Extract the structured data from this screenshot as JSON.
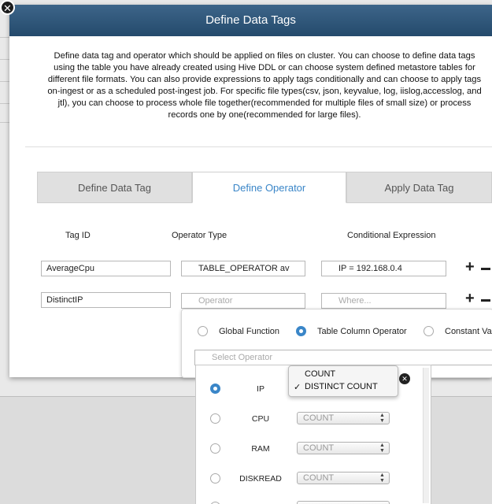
{
  "modal": {
    "title": "Define Data Tags",
    "close_glyph": "✕",
    "description": "Define data tag and operator which should be applied on files on cluster. You can choose to define data tags using the table you have already created using Hive DDL or can choose system defined metastore tables for different file formats. You can also provide expressions to apply tags conditionally and can choose to apply tags on-ingest or as a scheduled post-ingest job. For specific file types(csv, json, keyvalue, log, iislog,accesslog, and jtl), you can choose to process whole file together(recommended for multiple files of small size) or process records one by one(recommended for large files)."
  },
  "tabs": [
    {
      "label": "Define Data Tag",
      "active": false
    },
    {
      "label": "Define Operator",
      "active": true
    },
    {
      "label": "Apply Data Tag",
      "active": false
    }
  ],
  "table": {
    "headers": {
      "tag_id": "Tag ID",
      "operator_type": "Operator Type",
      "conditional_expression": "Conditional Expression"
    },
    "rows": [
      {
        "tag_id": "AverageCpu",
        "operator": "TABLE_OPERATOR av",
        "operator_placeholder": "Operator",
        "expression": "IP = 192.168.0.4",
        "expression_placeholder": "Where..."
      },
      {
        "tag_id": "DistinctIP",
        "operator": "",
        "operator_placeholder": "Operator",
        "expression": "",
        "expression_placeholder": "Where..."
      }
    ],
    "add_glyph": "+"
  },
  "operator_popup": {
    "options": [
      {
        "label": "Global Function",
        "selected": false
      },
      {
        "label": "Table Column Operator",
        "selected": true
      },
      {
        "label": "Constant Val",
        "selected": false
      }
    ],
    "select_placeholder": "Select Operator",
    "columns": [
      {
        "name": "IP",
        "selected": true,
        "value": "DISTINCT COUNT"
      },
      {
        "name": "CPU",
        "selected": false,
        "value": "COUNT"
      },
      {
        "name": "RAM",
        "selected": false,
        "value": "COUNT"
      },
      {
        "name": "DISKREAD",
        "selected": false,
        "value": "COUNT"
      }
    ],
    "dropdown_options": [
      "COUNT",
      "DISTINCT COUNT"
    ],
    "check_glyph": "✓",
    "select_arrows": "▲▼",
    "remove_glyph": "✕"
  },
  "colors": {
    "header": "#2c5577",
    "accent": "#3a86c8"
  }
}
